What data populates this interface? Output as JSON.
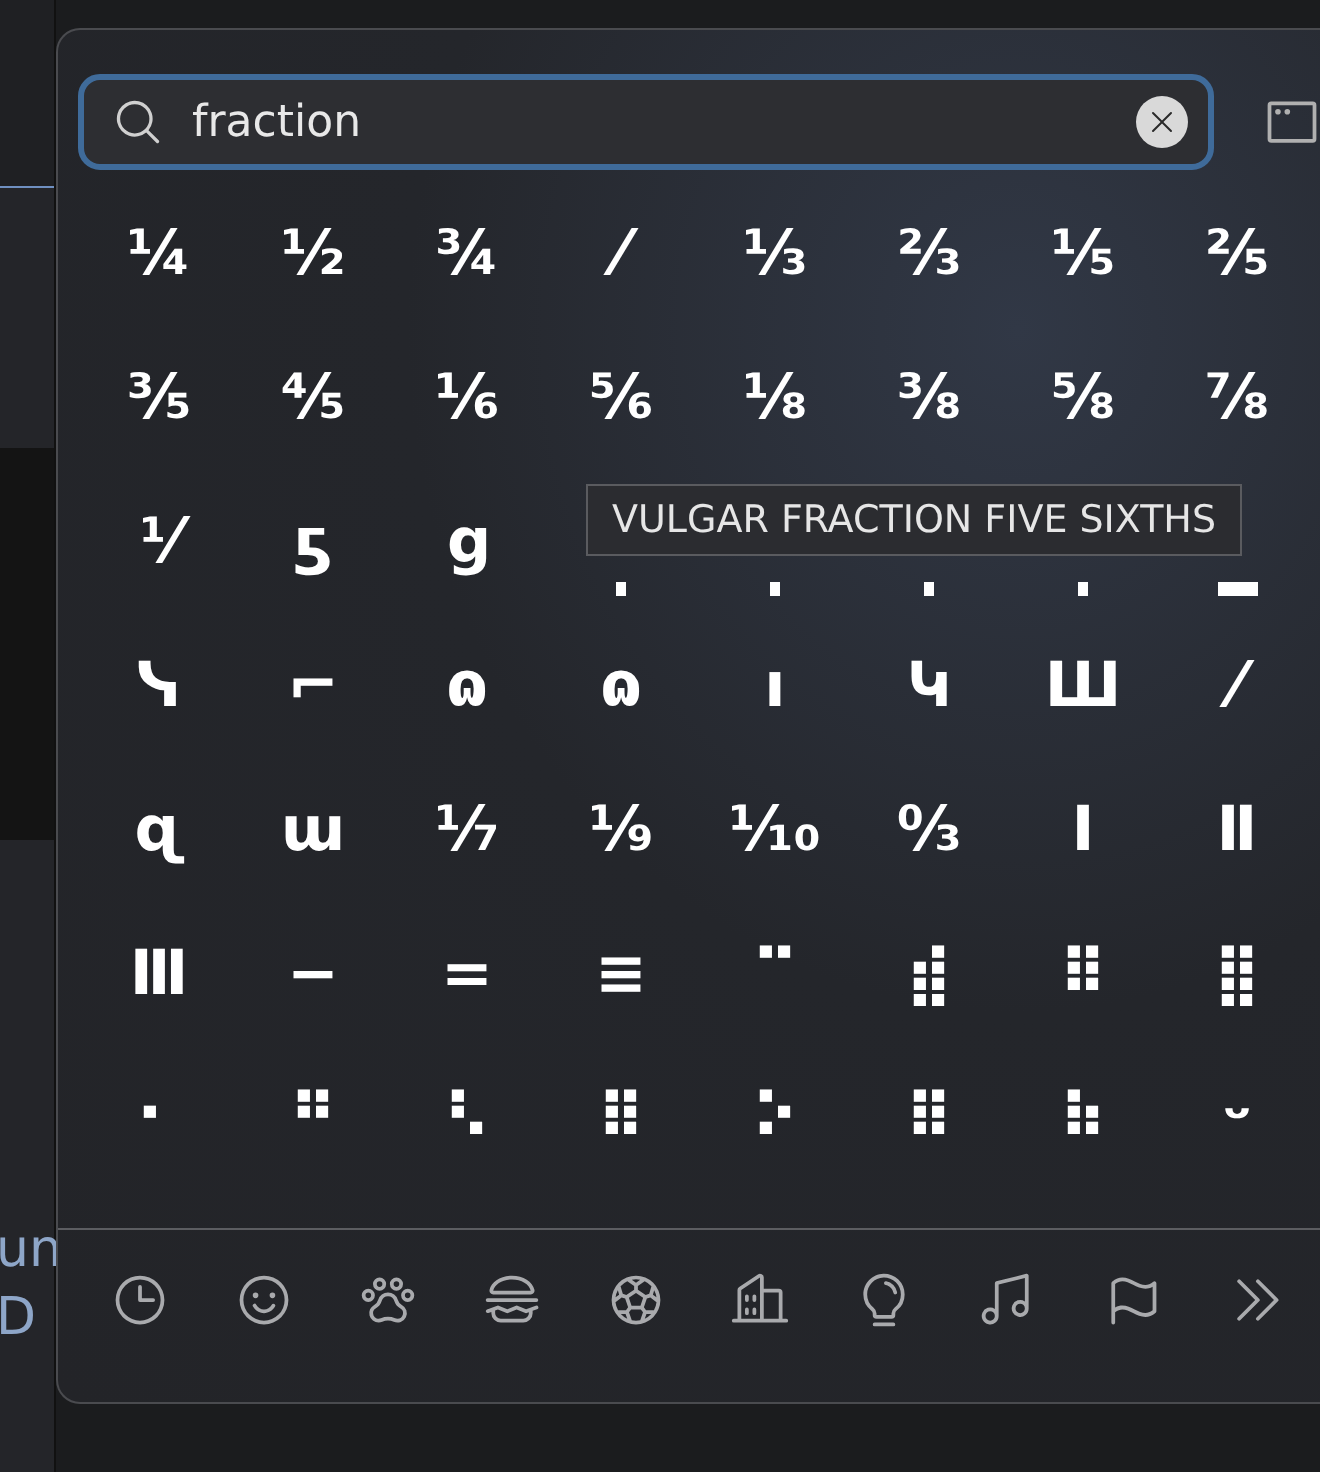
{
  "search": {
    "value": "fraction"
  },
  "characters": [
    [
      "¼",
      "½",
      "¾",
      "⁄",
      "⅓",
      "⅔",
      "⅕",
      "⅖"
    ],
    [
      "⅗",
      "⅘",
      "⅙",
      "⅚",
      "⅛",
      "⅜",
      "⅝",
      "⅞"
    ],
    [
      "⅟",
      "ƽ",
      "ց"
    ],
    [
      "ᓭ",
      "⌐",
      "ɷ",
      "ɷ",
      "ı",
      "Կ",
      "Ш",
      "⁄"
    ],
    [
      "ɋ",
      "ɯ",
      "⅐",
      "⅑",
      "⅒",
      "↉",
      "Ⅰ",
      "Ⅱ"
    ],
    [
      "Ⅲ",
      "−",
      "=",
      "≡",
      "⠉",
      "⣾",
      "⠿",
      "⣿"
    ],
    [
      "⠂",
      "⠛",
      "⠣",
      "⠿",
      "⠕",
      "⠿",
      "⠷",
      "ᵕ"
    ]
  ],
  "tooltip": {
    "text": "VULGAR FRACTION FIVE SIXTHS"
  },
  "background_text": [
    "un",
    "D"
  ]
}
